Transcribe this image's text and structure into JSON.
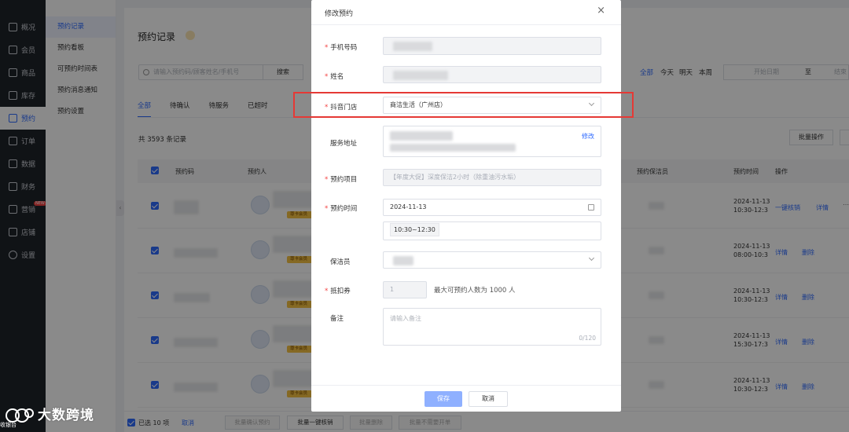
{
  "sidebar": {
    "items": [
      {
        "label": "概况",
        "icon": "dashboard-icon"
      },
      {
        "label": "会员",
        "icon": "crown-icon"
      },
      {
        "label": "商品",
        "icon": "shop-icon"
      },
      {
        "label": "库存",
        "icon": "inventory-icon"
      },
      {
        "label": "预约",
        "icon": "check-calendar-icon"
      },
      {
        "label": "订单",
        "icon": "order-icon"
      },
      {
        "label": "数据",
        "icon": "chart-icon"
      },
      {
        "label": "财务",
        "icon": "finance-icon"
      },
      {
        "label": "营销",
        "icon": "gift-icon",
        "badge": "NEW"
      },
      {
        "label": "店铺",
        "icon": "store-icon"
      },
      {
        "label": "设置",
        "icon": "settings-icon"
      }
    ]
  },
  "submenu": {
    "items": [
      "预约记录",
      "预约看板",
      "可预约时间表",
      "预约消息通知",
      "预约设置"
    ]
  },
  "page": {
    "title": "预约记录",
    "search_placeholder": "请输入预约码/顾客姓名/手机号",
    "search_button": "搜索",
    "date_quick": [
      "全部",
      "今天",
      "明天",
      "本周"
    ],
    "start_date_placeholder": "开始日期",
    "date_sep": "至",
    "end_date_placeholder": "结束",
    "tabs": [
      "全部",
      "待确认",
      "待服务",
      "已超时"
    ],
    "record_count": "共 3593 条记录",
    "batch_button": "批量操作",
    "columns": [
      "预约码",
      "预约人",
      "预约保洁员",
      "预约时间",
      "操作"
    ],
    "rows": [
      {
        "time": "2024-11-13",
        "slot": "10:30-12:3",
        "ops": [
          "一键核销",
          "详情"
        ],
        "vip": "尊卡会员"
      },
      {
        "time": "2024-11-13",
        "slot": "08:00-10:3",
        "ops": [
          "详情",
          "删除"
        ],
        "vip": "尊卡会员"
      },
      {
        "time": "2024-11-13",
        "slot": "10:30-12:3",
        "ops": [
          "详情",
          "删除"
        ],
        "vip": "尊卡会员"
      },
      {
        "time": "2024-11-13",
        "slot": "15:30-17:3",
        "ops": [
          "详情",
          "删除"
        ],
        "vip": "尊卡会员"
      },
      {
        "time": "2024-11-13",
        "slot": "10:30-12:3",
        "ops": [
          "详情",
          "删除"
        ],
        "vip": "尊卡会员"
      }
    ],
    "footer": {
      "selected": "已选 10 项",
      "cancel": "取消",
      "buttons": [
        "批量确认预约",
        "批量一键核销",
        "批量删除",
        "批量不需要开单"
      ]
    }
  },
  "watermark": {
    "text": "大数跨境",
    "sub": "收银台"
  },
  "modal": {
    "title": "修改预约",
    "close": "×",
    "fields": {
      "phone_label": "手机号码",
      "name_label": "姓名",
      "store_label": "抖音门店",
      "store_value": "商洁生活（广州店）",
      "address_label": "服务地址",
      "address_edit": "修改",
      "project_label": "预约项目",
      "project_value": "【年度大促】深度保洁2小时（除重油污水垢）",
      "time_label": "预约时间",
      "date_value": "2024-11-13",
      "slot_value": "10:30~12:30",
      "cleaner_label": "保洁员",
      "voucher_label": "抵扣券",
      "voucher_value": "1",
      "voucher_hint": "最大可预约人数为 1000 人",
      "note_label": "备注",
      "note_placeholder": "请输入备注",
      "note_count": "0/120"
    },
    "save": "保存",
    "cancel": "取消"
  },
  "colors": {
    "accent": "#2f6bff",
    "highlight": "#e53935",
    "sidebar_bg": "#1f2329"
  }
}
